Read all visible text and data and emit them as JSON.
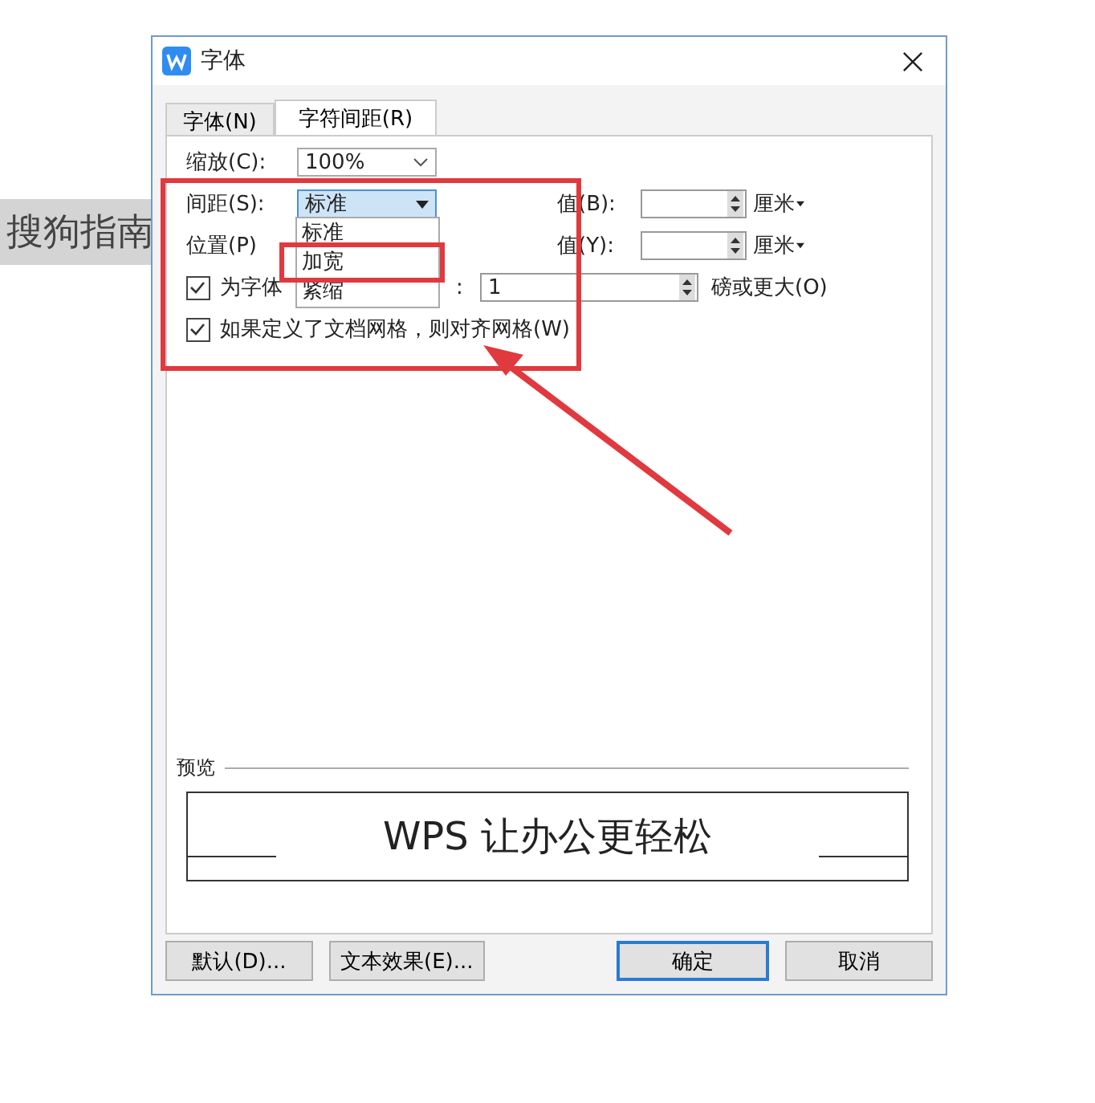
{
  "background_text": "搜狗指南",
  "window": {
    "title": "字体"
  },
  "tabs": [
    {
      "label": "字体(N)",
      "selected": false
    },
    {
      "label": "字符间距(R)",
      "selected": true
    }
  ],
  "scale": {
    "label": "缩放(C):",
    "value": "100%"
  },
  "spacing": {
    "label": "间距(S):",
    "value": "标准",
    "value_label": "值(B):",
    "unit": "厘米"
  },
  "position": {
    "label": "位置(P)",
    "value_label": "值(Y):",
    "unit": "厘米"
  },
  "kerning": {
    "label": "为字体",
    "colon": ":",
    "value": "1",
    "suffix": "磅或更大(O)",
    "checked": true
  },
  "grid": {
    "label": "如果定义了文档网格，则对齐网格(W)",
    "checked": true
  },
  "dropdown": {
    "options": [
      "标准",
      "加宽",
      "紧缩"
    ]
  },
  "preview": {
    "label": "预览",
    "sample": "WPS 让办公更轻松"
  },
  "buttons": [
    {
      "label": "默认(D)...",
      "kind": "secondary"
    },
    {
      "label": "文本效果(E)...",
      "kind": "secondary"
    },
    {
      "label": "确定",
      "kind": "default"
    },
    {
      "label": "取消",
      "kind": "secondary"
    }
  ]
}
